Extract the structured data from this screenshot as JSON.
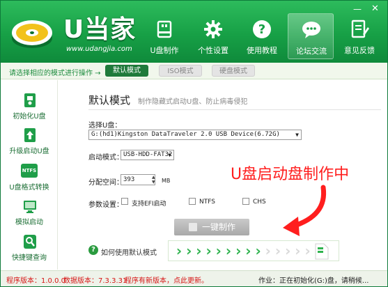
{
  "header": {
    "logo_title": "U当家",
    "logo_url": "www.udangjia.com",
    "window_controls": {
      "minimize": "—",
      "close": "✕"
    },
    "nav": [
      {
        "label": "U盘制作",
        "icon": "usb-drive-icon",
        "active": false
      },
      {
        "label": "个性设置",
        "icon": "gear-icon",
        "active": false
      },
      {
        "label": "使用教程",
        "icon": "help-icon",
        "active": false
      },
      {
        "label": "论坛交流",
        "icon": "chat-bubbles-icon",
        "active": true
      },
      {
        "label": "意见反馈",
        "icon": "feedback-edit-icon",
        "active": false
      }
    ]
  },
  "modebar": {
    "hint": "请选择相应的模式进行操作 →",
    "modes": [
      {
        "label": "默认模式",
        "active": true
      },
      {
        "label": "ISO模式",
        "active": false
      },
      {
        "label": "硬盘模式",
        "active": false
      }
    ]
  },
  "sidebar": {
    "items": [
      {
        "label": "初始化U盘",
        "icon": "init-usb-icon"
      },
      {
        "label": "升级启动U盘",
        "icon": "upgrade-usb-icon"
      },
      {
        "label": "U盘格式转换",
        "icon": "ntfs-convert-icon",
        "badge": "NTFS"
      },
      {
        "label": "模拟启动",
        "icon": "monitor-icon"
      },
      {
        "label": "快捷键查询",
        "icon": "key-lookup-icon"
      }
    ]
  },
  "main": {
    "title": "默认模式",
    "subtitle": "制作隐藏式启动U盘、防止病毒侵犯",
    "usb_label": "选择U盘：",
    "usb_value": "G:(hd1)Kingston DataTraveler 2.0 USB Device(6.72G)",
    "boot_label": "启动模式：",
    "boot_value": "USB-HDD-FAT32",
    "alloc_label": "分配空间：",
    "alloc_value": "393",
    "alloc_unit": "MB",
    "params_label": "参数设置：",
    "options": [
      {
        "label": "支持EFI启动",
        "checked": false
      },
      {
        "label": "NTFS",
        "checked": false
      },
      {
        "label": "CHS",
        "checked": false
      }
    ],
    "make_button": "一键制作",
    "howto": "如何使用默认模式",
    "progress": {
      "filled_steps": 9,
      "total_steps": 14
    },
    "overlay": "U盘启动盘制作中"
  },
  "status": {
    "version": "程序版本：1.0.0.0",
    "data_version": "数据版本：7.3.3.31",
    "update_notice": "程序有新版本，点此更新。",
    "job": "作业：正在初始化(G:)盘，请稍候..."
  },
  "colors": {
    "brand_green": "#17a046",
    "mode_active": "#1f7a3b",
    "progress_done": "#2fb34e",
    "progress_todo": "#d9d9d9",
    "alert_red": "#ff1e1e"
  }
}
